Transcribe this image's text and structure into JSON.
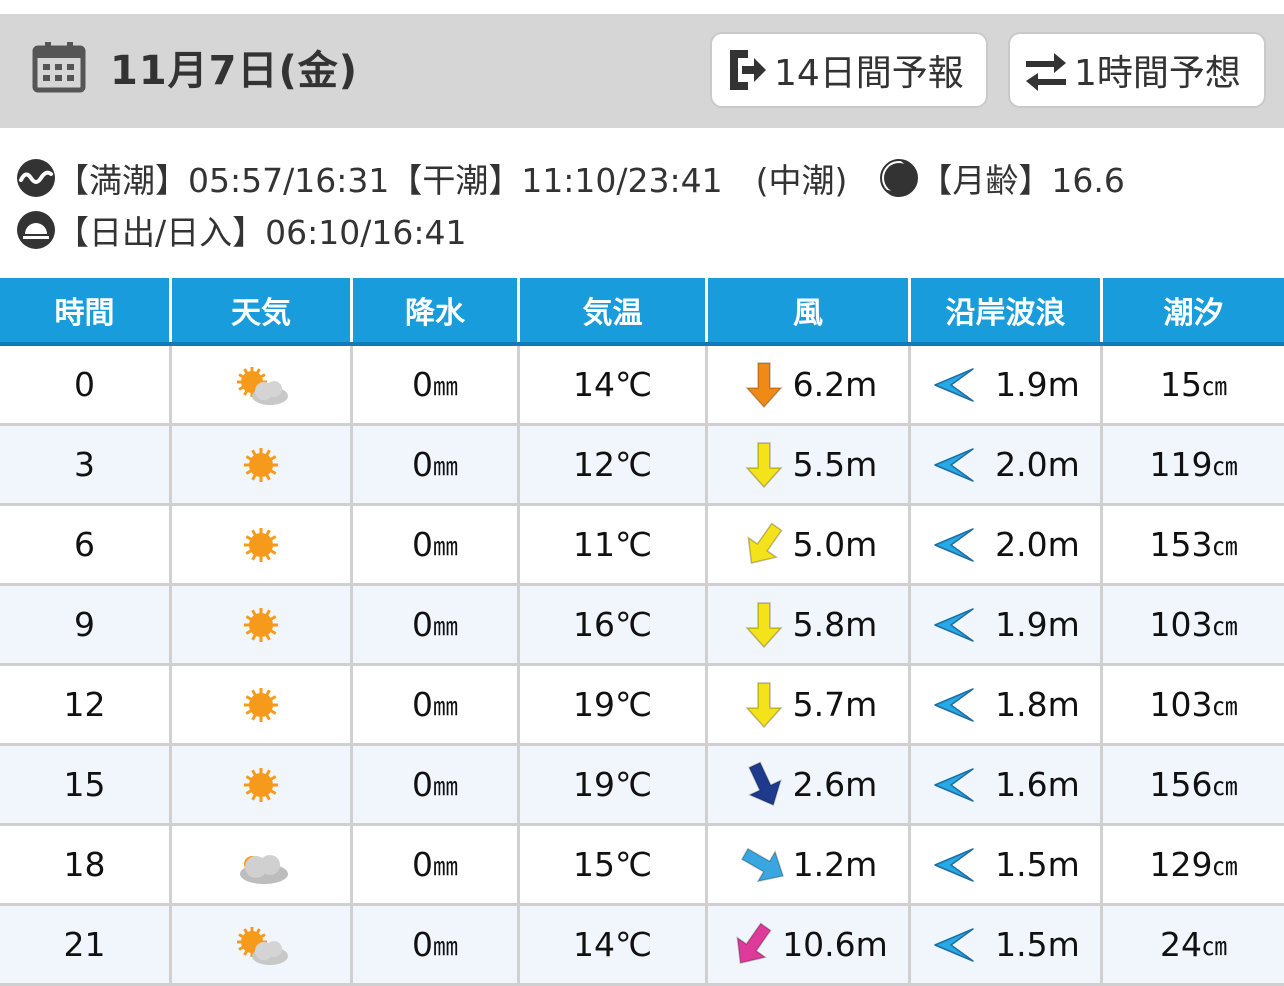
{
  "header": {
    "date": "11月7日(金)",
    "btn_14day": "14日間予報",
    "btn_1hour": "1時間予想"
  },
  "info": {
    "tide_text": "【満潮】05:57/16:31【干潮】11:10/23:41　(中潮)",
    "moon_text": "【月齢】16.6",
    "sun_text": "【日出/日入】06:10/16:41"
  },
  "table": {
    "headers": [
      "時間",
      "天気",
      "降水",
      "気温",
      "風",
      "沿岸波浪",
      "潮汐"
    ],
    "rows": [
      {
        "time": "0",
        "weather": "sunny-cloudy-icon",
        "rain": "0",
        "rain_unit": "㎜",
        "temp": "14℃",
        "wind_dir": 180,
        "wind_color": "#f08a17",
        "wind": "6.2m",
        "wave": "1.9m",
        "tide": "15",
        "tide_unit": "㎝"
      },
      {
        "time": "3",
        "weather": "sun-icon",
        "rain": "0",
        "rain_unit": "㎜",
        "temp": "12℃",
        "wind_dir": 180,
        "wind_color": "#f4e21a",
        "wind": "5.5m",
        "wave": "2.0m",
        "tide": "119",
        "tide_unit": "㎝"
      },
      {
        "time": "6",
        "weather": "sun-icon",
        "rain": "0",
        "rain_unit": "㎜",
        "temp": "11℃",
        "wind_dir": 215,
        "wind_color": "#f4e21a",
        "wind": "5.0m",
        "wave": "2.0m",
        "tide": "153",
        "tide_unit": "㎝"
      },
      {
        "time": "9",
        "weather": "sun-icon",
        "rain": "0",
        "rain_unit": "㎜",
        "temp": "16℃",
        "wind_dir": 180,
        "wind_color": "#f4e21a",
        "wind": "5.8m",
        "wave": "1.9m",
        "tide": "103",
        "tide_unit": "㎝"
      },
      {
        "time": "12",
        "weather": "sun-icon",
        "rain": "0",
        "rain_unit": "㎜",
        "temp": "19℃",
        "wind_dir": 180,
        "wind_color": "#f4e21a",
        "wind": "5.7m",
        "wave": "1.8m",
        "tide": "103",
        "tide_unit": "㎝"
      },
      {
        "time": "15",
        "weather": "sun-icon",
        "rain": "0",
        "rain_unit": "㎜",
        "temp": "19℃",
        "wind_dir": 155,
        "wind_color": "#1e3a8c",
        "wind": "2.6m",
        "wave": "1.6m",
        "tide": "156",
        "tide_unit": "㎝"
      },
      {
        "time": "18",
        "weather": "cloudy-icon",
        "rain": "0",
        "rain_unit": "㎜",
        "temp": "15℃",
        "wind_dir": 120,
        "wind_color": "#3aa6e0",
        "wind": "1.2m",
        "wave": "1.5m",
        "tide": "129",
        "tide_unit": "㎝"
      },
      {
        "time": "21",
        "weather": "sunny-cloudy-icon",
        "rain": "0",
        "rain_unit": "㎜",
        "temp": "14℃",
        "wind_dir": 215,
        "wind_color": "#de3a9a",
        "wind": "10.6m",
        "wave": "1.5m",
        "tide": "24",
        "tide_unit": "㎝"
      }
    ]
  },
  "colors": {
    "header_bg": "#199cdb",
    "wave_arrow": "#29a8e8",
    "sun": "#f59a1b"
  }
}
